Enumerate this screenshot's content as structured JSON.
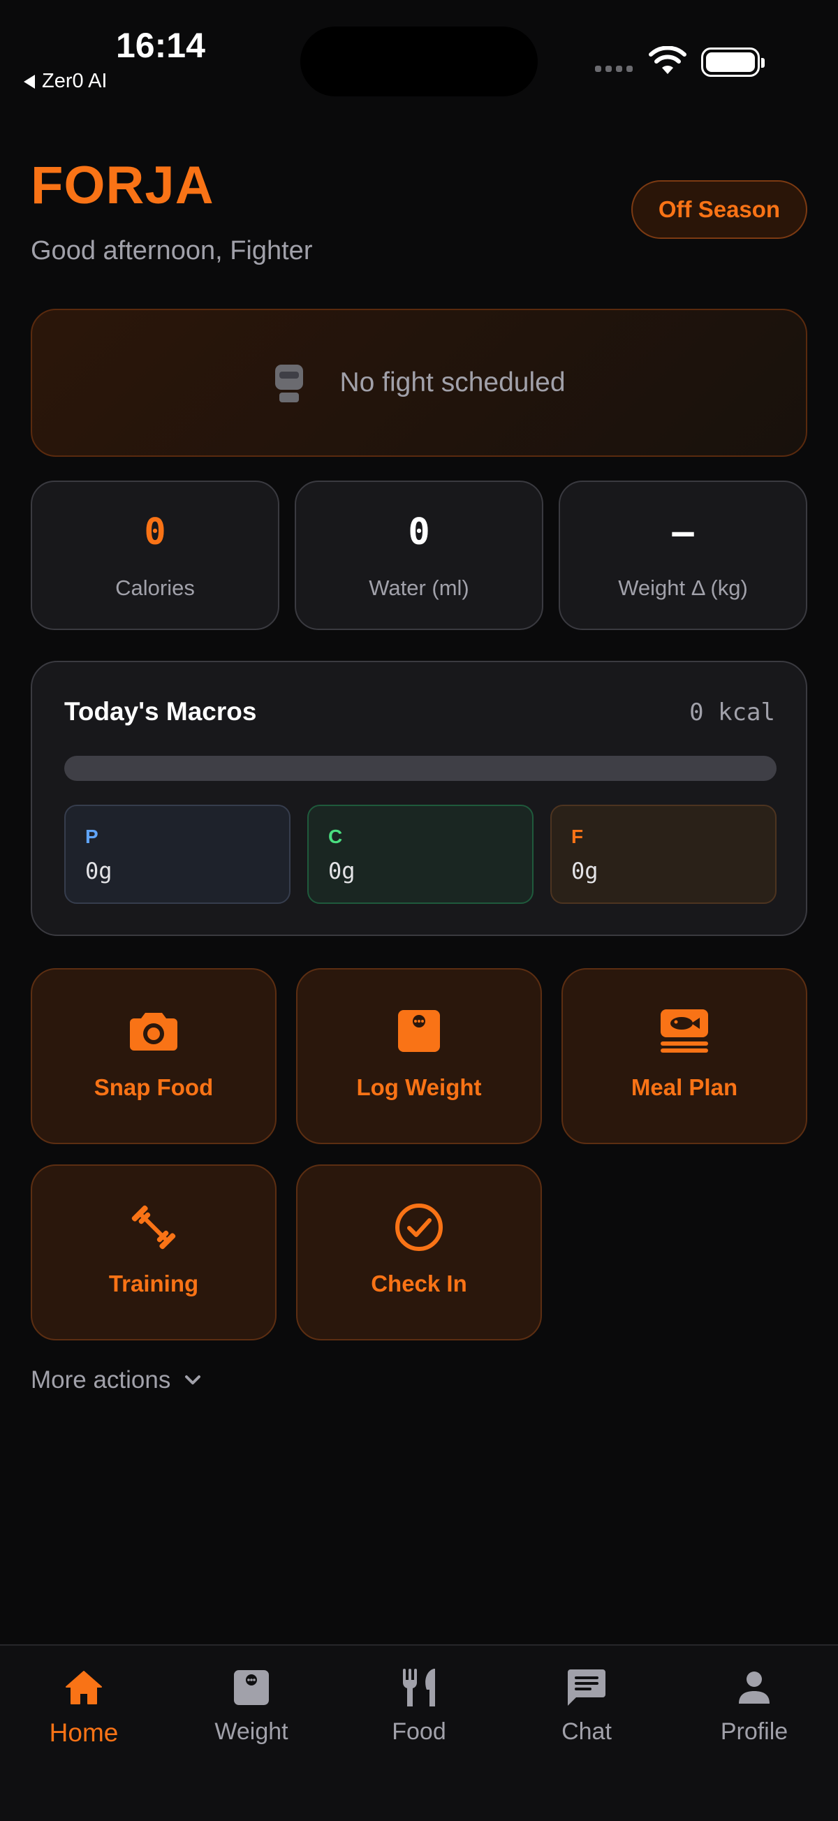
{
  "status_bar": {
    "time": "16:14",
    "back_app": "Zer0 AI"
  },
  "header": {
    "brand": "FORJA",
    "greeting": "Good afternoon, Fighter",
    "season_badge": "Off Season"
  },
  "fight": {
    "icon": "boxing-glove-icon",
    "text": "No fight scheduled"
  },
  "stats": [
    {
      "value": "0",
      "label": "Calories",
      "color": "#f97316"
    },
    {
      "value": "0",
      "label": "Water (ml)",
      "color": "#ffffff"
    },
    {
      "value": "–",
      "label": "Weight Δ (kg)",
      "color": "#ffffff"
    }
  ],
  "macros": {
    "title": "Today's Macros",
    "kcal": "0 kcal",
    "progress": 0,
    "items": [
      {
        "letter": "P",
        "grams": "0g",
        "color": "#60a5fa"
      },
      {
        "letter": "C",
        "grams": "0g",
        "color": "#4ade80"
      },
      {
        "letter": "F",
        "grams": "0g",
        "color": "#f97316"
      }
    ]
  },
  "actions": [
    {
      "label": "Snap Food",
      "icon": "camera-icon"
    },
    {
      "label": "Log Weight",
      "icon": "scale-icon"
    },
    {
      "label": "Meal Plan",
      "icon": "fish-meal-icon"
    },
    {
      "label": "Training",
      "icon": "barbell-icon"
    },
    {
      "label": "Check In",
      "icon": "check-circle-icon"
    }
  ],
  "more_actions": "More actions",
  "nav": [
    {
      "label": "Home",
      "icon": "home-icon",
      "active": true
    },
    {
      "label": "Weight",
      "icon": "scale-icon",
      "active": false
    },
    {
      "label": "Food",
      "icon": "fork-knife-icon",
      "active": false
    },
    {
      "label": "Chat",
      "icon": "chat-icon",
      "active": false
    },
    {
      "label": "Profile",
      "icon": "person-icon",
      "active": false
    }
  ],
  "colors": {
    "accent": "#f97316",
    "background": "#0a0a0b",
    "card": "#18181b",
    "muted_text": "#a1a1aa"
  }
}
